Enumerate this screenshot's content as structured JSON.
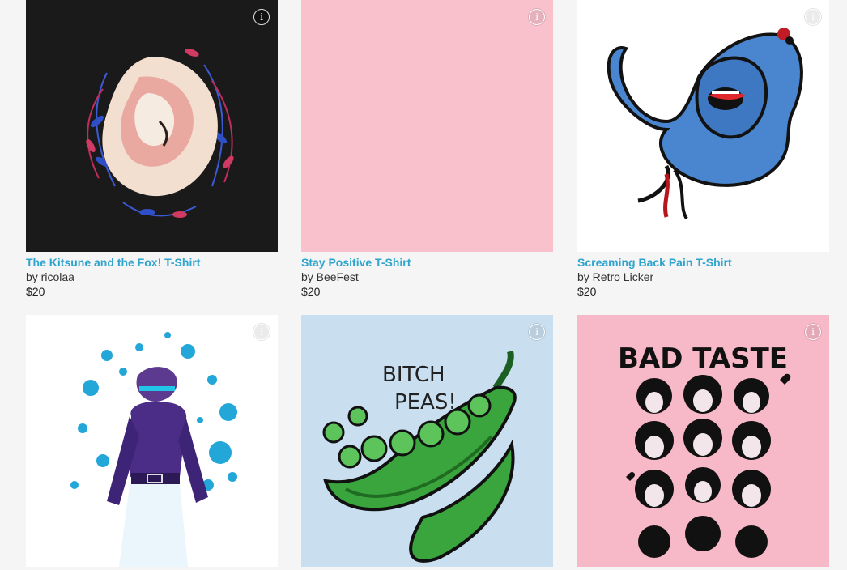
{
  "products": [
    {
      "title": "The Kitsune and the Fox! T-Shirt",
      "artist": "by ricolaa",
      "price": "$20",
      "bg": "#1b1a1b",
      "art": "kitsune-fox-illustration"
    },
    {
      "title": "Stay Positive T-Shirt",
      "artist": "by BeeFest",
      "price": "$20",
      "bg": "#f8c1cc",
      "art": "blank-pink-design"
    },
    {
      "title": "Screaming Back Pain T-Shirt",
      "artist": "by Retro Licker",
      "price": "$20",
      "bg": "#ffffff",
      "art": "screaming-figure-illustration"
    },
    {
      "title": "",
      "artist": "",
      "price": "",
      "bg": "#ffffff",
      "art": "paint-splatter-figure-illustration"
    },
    {
      "title": "",
      "artist": "",
      "price": "",
      "bg": "#c9dff0",
      "art": "bitch-peas-illustration",
      "art_text": [
        "BITCH",
        "PEAS!"
      ]
    },
    {
      "title": "",
      "artist": "",
      "price": "",
      "bg": "#f7b8c8",
      "art": "bad-taste-skulls-illustration",
      "art_text": [
        "BAD TASTE"
      ]
    }
  ],
  "info_icon": "i"
}
